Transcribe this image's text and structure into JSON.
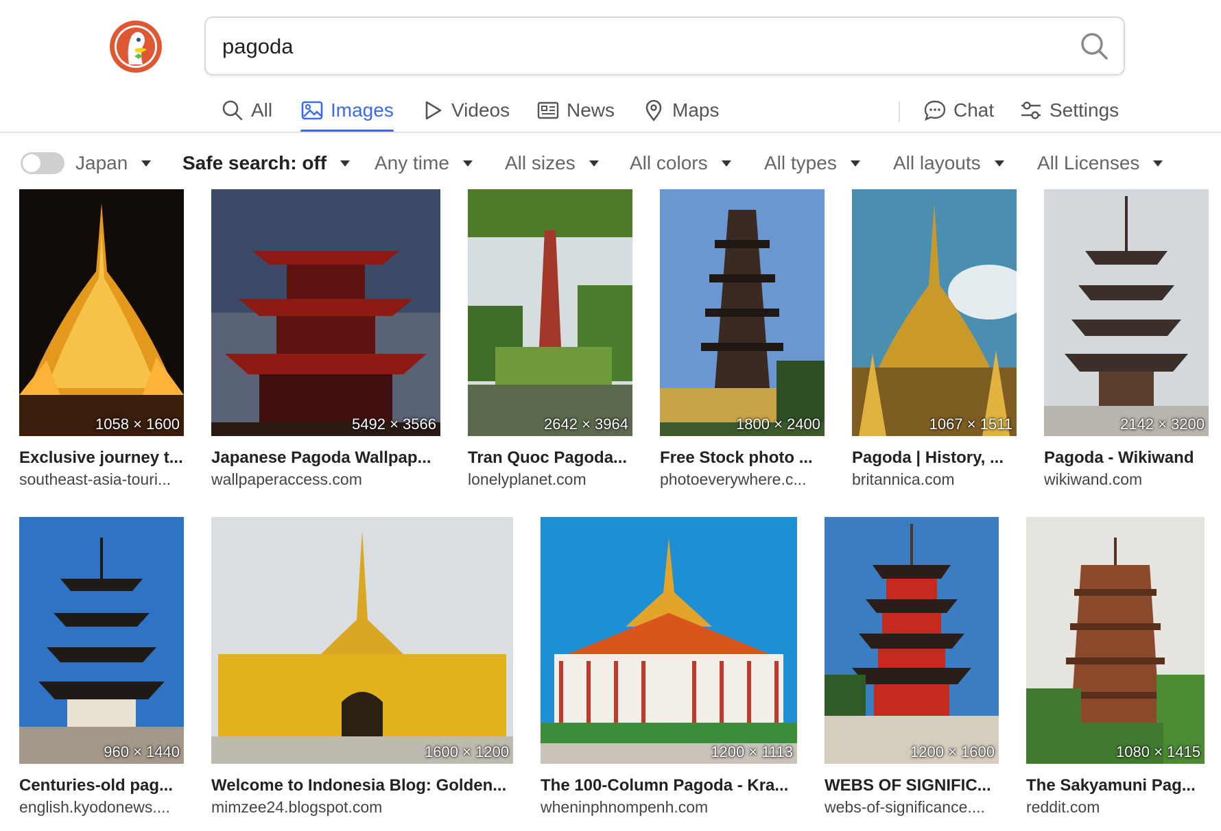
{
  "search": {
    "query": "pagoda"
  },
  "tabs": {
    "all": "All",
    "images": "Images",
    "videos": "Videos",
    "news": "News",
    "maps": "Maps",
    "chat": "Chat",
    "settings": "Settings"
  },
  "filters": {
    "region": "Japan",
    "safe_search": "Safe search: off",
    "time": "Any time",
    "size": "All sizes",
    "color": "All colors",
    "type": "All types",
    "layout": "All layouts",
    "license": "All Licenses"
  },
  "colors": {
    "accent": "#3969ef",
    "logo": "#de5833"
  },
  "results": [
    {
      "dims": "1058 × 1600",
      "title": "Exclusive journey t...",
      "source": "southeast-asia-touri..."
    },
    {
      "dims": "5492 × 3566",
      "title": "Japanese Pagoda Wallpap...",
      "source": "wallpaperaccess.com"
    },
    {
      "dims": "2642 × 3964",
      "title": "Tran Quoc Pagoda...",
      "source": "lonelyplanet.com"
    },
    {
      "dims": "1800 × 2400",
      "title": "Free Stock photo ...",
      "source": "photoeverywhere.c..."
    },
    {
      "dims": "1067 × 1511",
      "title": "Pagoda | History, ...",
      "source": "britannica.com"
    },
    {
      "dims": "2142 × 3200",
      "title": "Pagoda - Wikiwand",
      "source": "wikiwand.com"
    },
    {
      "dims": "960 × 1440",
      "title": "Centuries-old pag...",
      "source": "english.kyodonews...."
    },
    {
      "dims": "1600 × 1200",
      "title": "Welcome to Indonesia Blog: Golden...",
      "source": "mimzee24.blogspot.com"
    },
    {
      "dims": "1200 × 1113",
      "title": "The 100-Column Pagoda - Kra...",
      "source": "wheninphnompenh.com"
    },
    {
      "dims": "1200 × 1600",
      "title": "WEBS OF SIGNIFIC...",
      "source": "webs-of-significance...."
    },
    {
      "dims": "1080 × 1415",
      "title": "The Sakyamuni Pag...",
      "source": "reddit.com"
    }
  ]
}
